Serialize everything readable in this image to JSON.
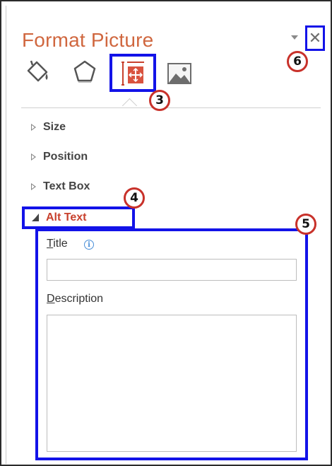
{
  "pane": {
    "title": "Format Picture",
    "close_label": "✕",
    "tabs": [
      {
        "name": "fill-line"
      },
      {
        "name": "effects"
      },
      {
        "name": "size-properties",
        "selected": true
      },
      {
        "name": "picture"
      }
    ]
  },
  "sections": {
    "size": "Size",
    "position": "Position",
    "text_box": "Text Box",
    "alt_text": "Alt Text"
  },
  "alt_text": {
    "title_accesskey": "T",
    "title_rest": "itle",
    "title_value": "",
    "description_accesskey": "D",
    "description_rest": "escription",
    "description_value": ""
  },
  "callouts": {
    "c3": "3",
    "c4": "4",
    "c5": "5",
    "c6": "6"
  },
  "colors": {
    "title": "#d0673f",
    "accent": "#c8412d",
    "highlight_box": "#1313e8",
    "callout_ring": "#c8312a"
  }
}
